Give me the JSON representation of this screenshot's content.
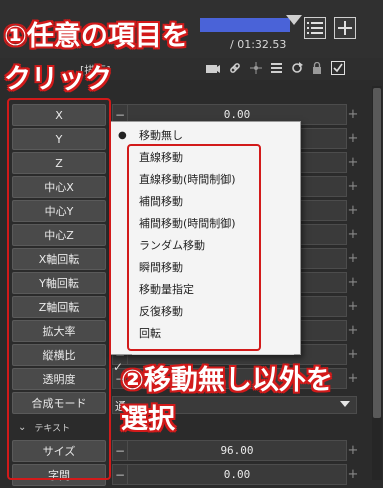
{
  "header": {
    "time_text": "/ 01:32.53",
    "layer_title": "[描画]"
  },
  "properties": {
    "items": [
      {
        "label": "X",
        "value": "0.00"
      },
      {
        "label": "Y",
        "value": ""
      },
      {
        "label": "Z",
        "value": ""
      },
      {
        "label": "中心X",
        "value": ""
      },
      {
        "label": "中心Y",
        "value": ""
      },
      {
        "label": "中心Z",
        "value": ""
      },
      {
        "label": "X軸回転",
        "value": ""
      },
      {
        "label": "Y軸回転",
        "value": ""
      },
      {
        "label": "Z軸回転",
        "value": ""
      },
      {
        "label": "拡大率",
        "value": ""
      },
      {
        "label": "縦横比",
        "value": ""
      },
      {
        "label": "透明度",
        "value": ""
      },
      {
        "label": "合成モード",
        "value": ""
      }
    ],
    "text_section_label": "テキスト",
    "text_items": [
      {
        "label": "サイズ",
        "value": "96.00"
      },
      {
        "label": "字間",
        "value": "0.00"
      }
    ],
    "blend_mode_value": "通"
  },
  "menu": {
    "items": [
      {
        "label": "移動無し",
        "selected": true
      },
      {
        "label": "直線移動",
        "selected": false
      },
      {
        "label": "直線移動(時間制御)",
        "selected": false
      },
      {
        "label": "補間移動",
        "selected": false
      },
      {
        "label": "補間移動(時間制御)",
        "selected": false
      },
      {
        "label": "ランダム移動",
        "selected": false
      },
      {
        "label": "瞬間移動",
        "selected": false
      },
      {
        "label": "移動量指定",
        "selected": false
      },
      {
        "label": "反復移動",
        "selected": false
      },
      {
        "label": "回転",
        "selected": false
      }
    ]
  },
  "annotations": {
    "step1_line1": "①任意の項目を",
    "step1_line2": "クリック",
    "step2_line1": "②移動無し以外を",
    "step2_line2": "選択"
  },
  "colors": {
    "annotation": "#d21a1a",
    "timeline_bar": "#4a63d8"
  }
}
